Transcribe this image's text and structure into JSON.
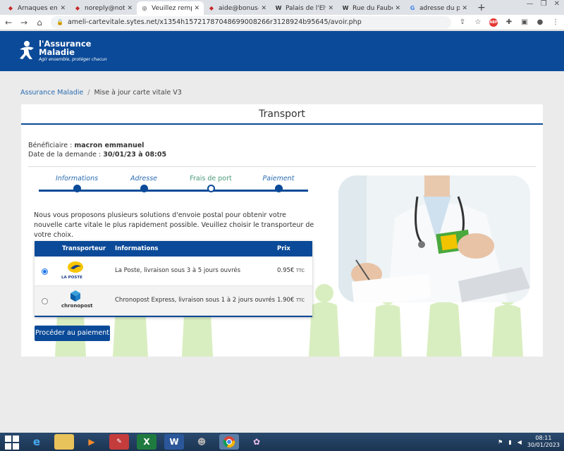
{
  "browser": {
    "tabs": [
      {
        "title": "Arnaques en lig",
        "icon": "scam-site-icon"
      },
      {
        "title": "noreply@notify",
        "icon": "mail-icon"
      },
      {
        "title": "Veuillez rempli",
        "icon": "globe-icon",
        "active": true
      },
      {
        "title": "aide@bonus-ec",
        "icon": "mail-icon"
      },
      {
        "title": "Palais de l'Élysé",
        "icon": "wikipedia-icon"
      },
      {
        "title": "Rue du Faubou",
        "icon": "wikipedia-icon"
      },
      {
        "title": "adresse du pala",
        "icon": "google-icon"
      }
    ],
    "new_tab": "+",
    "url": "ameli-cartevitale.sytes.net/x1354h15721787048699008266r3128924b95645/avoir.php"
  },
  "header": {
    "logo_line1": "l'Assurance",
    "logo_line2": "Maladie",
    "logo_tagline": "Agir ensemble, protéger chacun"
  },
  "breadcrumb": {
    "home": "Assurance Maladie",
    "current": "Mise à jour carte vitale V3"
  },
  "page": {
    "title": "Transport",
    "beneficiary_label": "Bénéficiaire : ",
    "beneficiary_value": "macron emmanuel",
    "date_label": "Date de la demande : ",
    "date_value": "30/01/23 à 08:05",
    "steps": [
      "Informations",
      "Adresse",
      "Frais de port",
      "Paiement"
    ],
    "intro": "Nous vous proposons plusieurs solutions d'envoie postal pour obtenir votre nouvelle carte vitale le plus rapidement possible. Veuillez choisir le transporteur de votre choix.",
    "table": {
      "headers": [
        "Transporteur",
        "Informations",
        "Prix"
      ],
      "rows": [
        {
          "brand": "LA POSTE",
          "info": "La Poste, livraison sous 3 à 5 jours ouvrés",
          "price": "0.95€",
          "unit": "TTC",
          "selected": true
        },
        {
          "brand": "chronopost",
          "info": "Chronopost Express, livraison sous 1 à 2 jours ouvrés",
          "price": "1.90€",
          "unit": "TTC",
          "selected": false
        }
      ]
    },
    "pay_button": "Procéder au paiement"
  },
  "taskbar": {
    "time": "08:11",
    "date": "30/01/2023"
  },
  "colors": {
    "brand_blue": "#0b4a98",
    "accent_green": "#c6dfa8"
  }
}
